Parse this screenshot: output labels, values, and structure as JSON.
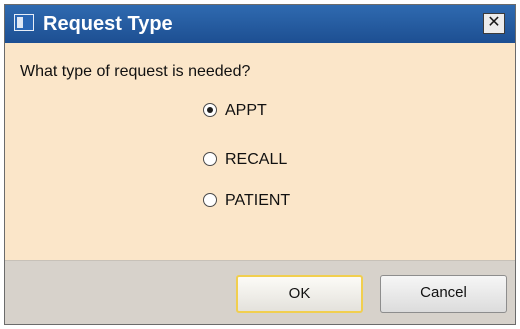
{
  "window": {
    "title": "Request Type",
    "close_glyph": "✕"
  },
  "question": "What type of request is needed?",
  "options": [
    {
      "label": "APPT",
      "selected": true
    },
    {
      "label": "RECALL",
      "selected": false
    },
    {
      "label": "PATIENT",
      "selected": false
    }
  ],
  "buttons": {
    "ok_label": "OK",
    "cancel_label": "Cancel"
  },
  "colors": {
    "title_bar": "#1d4f92",
    "content_bg": "#fbe6c9",
    "footer_bg": "#d7d2cb",
    "default_button_border": "#f1cf4f"
  }
}
